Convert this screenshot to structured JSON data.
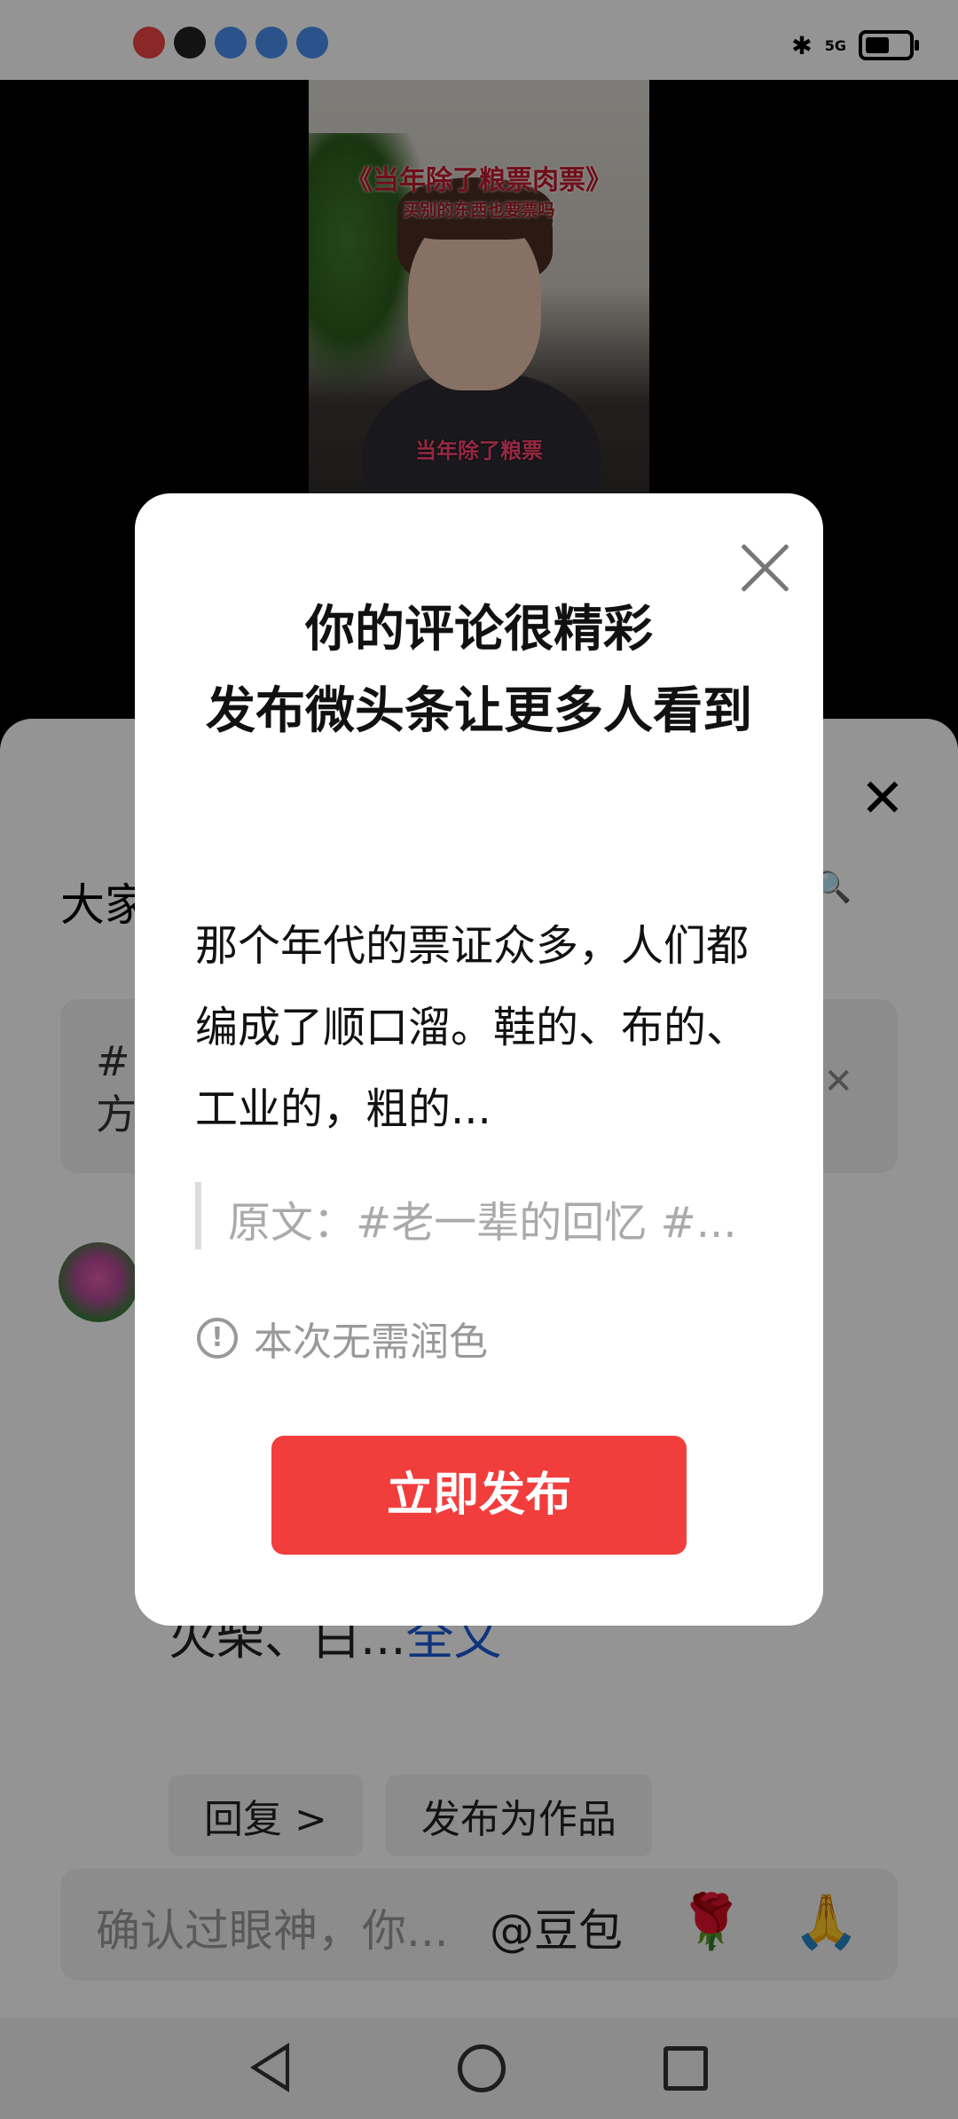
{
  "status_bar": {
    "signal": "5G"
  },
  "video": {
    "title_line1": "《当年除了粮票肉票》",
    "title_line2": "买别的东西也要票吗",
    "subtitle": "当年除了粮票"
  },
  "comment_panel": {
    "title": "大家",
    "hint": "#\n方",
    "comment_text": "都\n…\n另\n外还有肉票，纺织票，买碱面\n火柴、白...",
    "comment_more": "全文",
    "reply_button": "回复 >",
    "publish_as_work_button": "发布为作品"
  },
  "input_bar": {
    "placeholder": "确认过眼神，你...",
    "mention": "@豆包"
  },
  "dialog": {
    "title": "你的评论很精彩\n发布微头条让更多人看到",
    "content": "那个年代的票证众多，人们都编成了顺口溜。鞋的、布的、工业的，粗的...",
    "quote": "原文：#老一辈的回忆 #...",
    "notice": "本次无需润色",
    "publish_button": "立即发布"
  },
  "colors": {
    "accent_red": "#f23d3d",
    "link_blue": "#1a5bd6"
  }
}
